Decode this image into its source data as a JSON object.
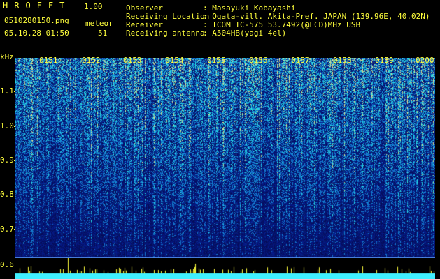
{
  "header": {
    "app_name": "HROFFT",
    "app_version": "1.00",
    "filename": "0510280150.png",
    "datetime": "05.10.28 01:50",
    "meteor_label": "meteor",
    "meteor_count": "51"
  },
  "info": {
    "labels": [
      "Observer",
      "Receiving Location",
      "Receiver",
      "Receiving antenna"
    ],
    "values": [
      ": Masayuki Kobayashi",
      ": Ogata-vill. Akita-Pref. JAPAN (139.96E, 40.02N)",
      ": ICOM IC-575 53.7492(@LCD)MHz USB",
      ": A504HB(yagi 4el)"
    ]
  },
  "spectrogram": {
    "y_unit": "kHz",
    "y_ticks": [
      "1.1",
      "1.0",
      "0.9",
      "0.8",
      "0.7",
      "0.6"
    ],
    "time_ticks": [
      "0151",
      "0152",
      "0153",
      "0154",
      "0155",
      "0156",
      "0157",
      "0158",
      "0159",
      "0200"
    ]
  },
  "colors": {
    "text_green": "#3cff3c",
    "text_yellow": "#ffff3c",
    "power_cyan": "#40f0ff",
    "background_blue": "#0a1a6e"
  }
}
